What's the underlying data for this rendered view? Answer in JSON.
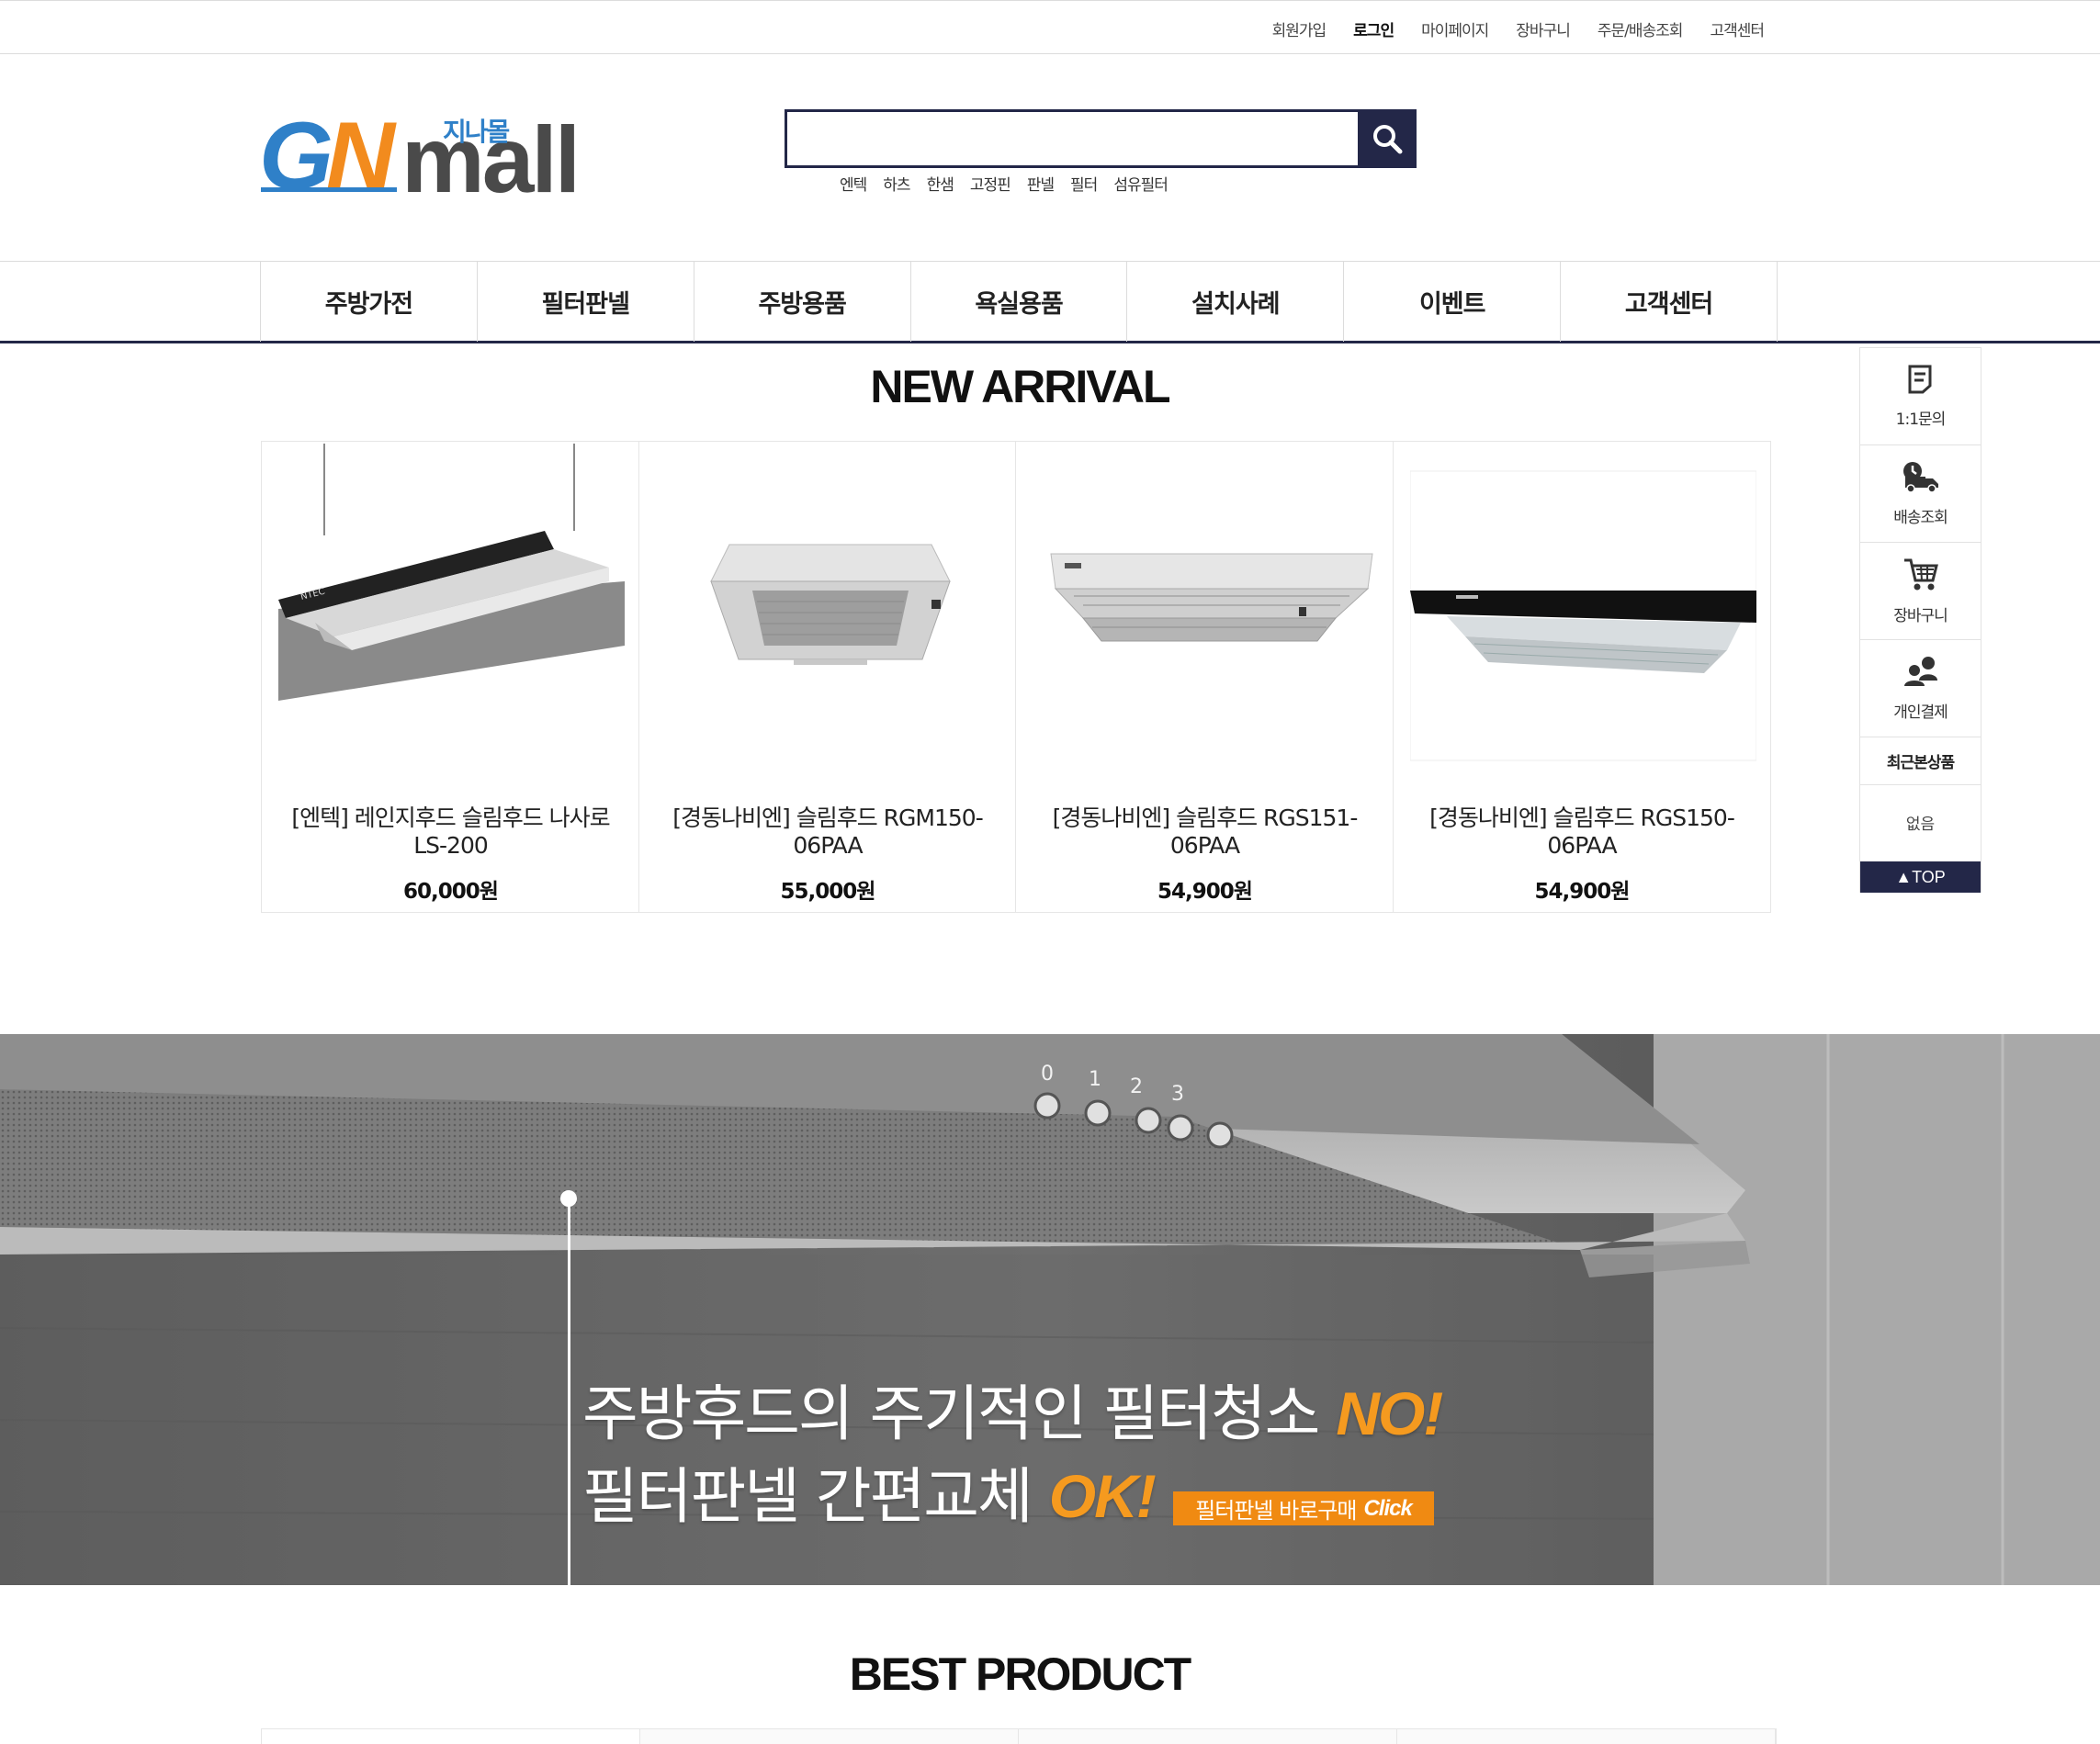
{
  "top_links": [
    "회원가입",
    "로그인",
    "마이페이지",
    "장바구니",
    "주문/배송조회",
    "고객센터"
  ],
  "logo": {
    "brand_gn_g": "G",
    "brand_gn_n": "N",
    "brand_mall": "mall",
    "brand_korean": "지나몰"
  },
  "search": {
    "placeholder": "",
    "value": ""
  },
  "keywords": [
    "엔텍",
    "하츠",
    "한샘",
    "고정핀",
    "판넬",
    "필터",
    "섬유필터"
  ],
  "nav": [
    "주방가전",
    "필터판넬",
    "주방용품",
    "욕실용품",
    "설치사례",
    "이벤트",
    "고객센터"
  ],
  "new_arrival": {
    "title": "NEW ARRIVAL",
    "products": [
      {
        "name": "[엔텍] 레인지후드 슬림후드 나사로 LS-200",
        "price": "60,000원"
      },
      {
        "name": "[경동나비엔] 슬림후드 RGM150-06PAA",
        "price": "55,000원"
      },
      {
        "name": "[경동나비엔] 슬림후드 RGS151-06PAA",
        "price": "54,900원"
      },
      {
        "name": "[경동나비엔] 슬림후드 RGS150-06PAA",
        "price": "54,900원"
      }
    ]
  },
  "quick_bar": {
    "items": [
      "1:1문의",
      "배송조회",
      "장바구니",
      "개인결제"
    ],
    "recent_title": "최근본상품",
    "recent_empty": "없음",
    "top_label": "▲TOP"
  },
  "banner": {
    "line1_text": "주방후드의 주기적인 필터청소 ",
    "line1_highlight": "NO!",
    "line2_text": "필터판넬 간편교체 ",
    "line2_highlight": "OK!",
    "cta_text": "필터판넬 바로구매",
    "cta_click": "Click",
    "knob_labels": [
      "0",
      "1",
      "2",
      "3"
    ]
  },
  "best_product": {
    "title": "BEST PRODUCT"
  },
  "colors": {
    "navy": "#232748",
    "accent_orange": "#f08a12",
    "logo_blue": "#2f80c8",
    "logo_orange": "#f28b1e"
  }
}
